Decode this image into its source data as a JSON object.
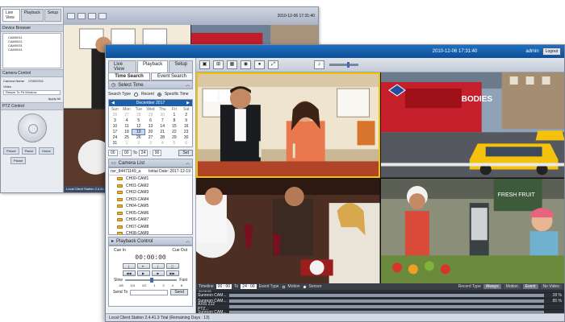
{
  "back_window": {
    "tabs": [
      "Live View",
      "Playback",
      "Setup"
    ],
    "device_browser_label": "Device Browser",
    "tree_items": [
      "CAM0011",
      "CAM0021",
      "CAM0031",
      "CAM0041"
    ],
    "camera_control_label": "Camera Control",
    "camera_name_label": "Camera Name",
    "camera_name_value": "CH002011",
    "video_label": "Video",
    "video_value": "Resize To Fit Window",
    "apply_all_label": "Apply All",
    "ptz_label": "PTZ Control",
    "preset_label": "Preset",
    "patrol_label": "Patrol",
    "pause_label": "Pause",
    "home_label": "Home",
    "clock": "2010-12-06 17:31:40",
    "status": "Local Client Station 2.4.41.3 Trial (Remaining Days : 13)"
  },
  "main_window": {
    "clock": "2010-12-06 17:31:40",
    "user": "admin",
    "logout_label": "Logout",
    "tabs": [
      {
        "label": "Live View",
        "active": false
      },
      {
        "label": "Playback",
        "active": true
      },
      {
        "label": "Setup",
        "active": false
      }
    ],
    "subtabs": [
      {
        "label": "Time Search",
        "active": true
      },
      {
        "label": "Event Search",
        "active": false
      }
    ],
    "select_time_label": "Select Time",
    "search_type_label": "Search Type",
    "recent_label": "Recent",
    "specific_time_label": "Specific Time",
    "calendar": {
      "month_label": "December 2017",
      "weekdays": [
        "Sun",
        "Mon",
        "Tue",
        "Wed",
        "Thu",
        "Fri",
        "Sat"
      ],
      "days": [
        {
          "d": "26",
          "dim": true
        },
        {
          "d": "27",
          "dim": true
        },
        {
          "d": "28",
          "dim": true
        },
        {
          "d": "29",
          "dim": true
        },
        {
          "d": "30",
          "dim": true
        },
        {
          "d": "1"
        },
        {
          "d": "2"
        },
        {
          "d": "3"
        },
        {
          "d": "4"
        },
        {
          "d": "5"
        },
        {
          "d": "6"
        },
        {
          "d": "7"
        },
        {
          "d": "8"
        },
        {
          "d": "9"
        },
        {
          "d": "10"
        },
        {
          "d": "11"
        },
        {
          "d": "12"
        },
        {
          "d": "13"
        },
        {
          "d": "14"
        },
        {
          "d": "15"
        },
        {
          "d": "16"
        },
        {
          "d": "17"
        },
        {
          "d": "18"
        },
        {
          "d": "19",
          "sel": true
        },
        {
          "d": "20"
        },
        {
          "d": "21"
        },
        {
          "d": "22"
        },
        {
          "d": "23"
        },
        {
          "d": "24"
        },
        {
          "d": "25"
        },
        {
          "d": "26"
        },
        {
          "d": "27"
        },
        {
          "d": "28"
        },
        {
          "d": "29"
        },
        {
          "d": "30"
        },
        {
          "d": "31"
        },
        {
          "d": "1",
          "dim": true
        },
        {
          "d": "2",
          "dim": true
        },
        {
          "d": "3",
          "dim": true
        },
        {
          "d": "4",
          "dim": true
        },
        {
          "d": "5",
          "dim": true
        },
        {
          "d": "6",
          "dim": true
        }
      ]
    },
    "time_from_h": "00",
    "time_from_m": "00",
    "to_label": "To",
    "time_to_h": "24",
    "time_to_m": "00",
    "set_label": "Set",
    "camera_list_label": "Camera List",
    "nvr_name": "nvr_84471149_a",
    "initial_date": "Initial Date: 2017-12-19",
    "cameras": [
      "CH00-CAM1",
      "CH01-CAM2",
      "CH02-CAM3",
      "CH03-CAM4",
      "CH04-CAM5",
      "CH05-CAM6",
      "CH06-CAM7",
      "CH07-CAM8",
      "CH08-CAM9"
    ],
    "playback_control_label": "Playback Control",
    "cue_in_label": "Cue In",
    "cue_out_label": "Cue Out",
    "playback_time": "00:00:00",
    "slow_label": "Slow",
    "fast_label": "Fast",
    "speed_ticks": [
      "1/8",
      "1/4",
      "1/2",
      "1",
      "2",
      "4",
      "8"
    ],
    "send_to_label": "Send To",
    "send_label": "Send",
    "timeline_label": "Timeline",
    "tl_from": "00 : 00",
    "tl_to_label": "To",
    "tl_to": "24 : 00",
    "event_type_label": "Event Type",
    "motion_label": "Motion",
    "sensor_label": "Sensor",
    "record_type_label": "Record Type",
    "rec_tags": [
      "Always",
      "Motion",
      "Event",
      "No Video"
    ],
    "tl_time": "00:00:05",
    "tl_rows": [
      {
        "name": "Sunreon CAM...",
        "pct": "28 %"
      },
      {
        "name": "Sunreon CAM...",
        "pct": "85 %"
      },
      {
        "name": "AXIS 212 PTZ...",
        "pct": ""
      },
      {
        "name": "Sunreon CAM...",
        "pct": ""
      }
    ],
    "status": "Local Client Station 2.4.41.3 Trial (Remaining Days : 13)"
  },
  "video_tiles": {
    "bus_sign": "BODIES",
    "pizza_sign": "FRESH FRUIT",
    "taxi_color": "#f4c20d"
  }
}
